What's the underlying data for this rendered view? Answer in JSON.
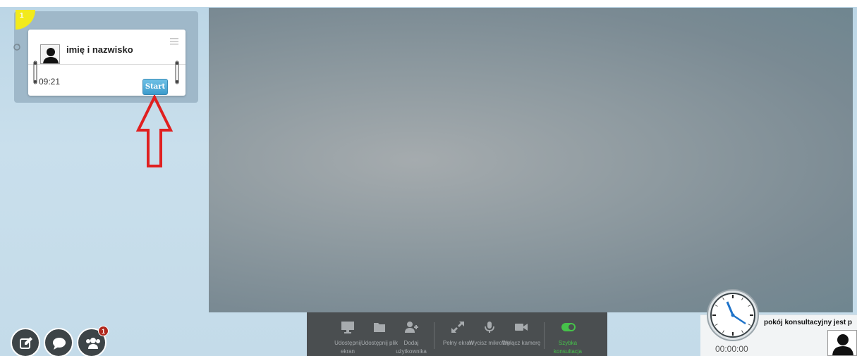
{
  "queue": {
    "count": "1",
    "client_name": "imię i nazwisko",
    "wait_time": "09:21",
    "start_label": "Start"
  },
  "footer_buttons": [
    {
      "icon": "edit-icon"
    },
    {
      "icon": "chat-icon"
    },
    {
      "icon": "users-icon",
      "badge": "1"
    }
  ],
  "toolbar": {
    "items": [
      {
        "icon": "monitor-icon",
        "label": "Udostępnij ekran"
      },
      {
        "icon": "folder-icon",
        "label": "Udostępnij plik"
      },
      {
        "icon": "add-user-icon",
        "label": "Dodaj użytkownika"
      },
      {
        "icon": "expand-icon",
        "label": "Pełny ekran"
      },
      {
        "icon": "microphone-icon",
        "label": "Wycisz mikrofon"
      },
      {
        "icon": "camera-icon",
        "label": "Wyłącz kamerę"
      },
      {
        "icon": "toggle-icon",
        "label": "Szybka konsultacja"
      }
    ]
  },
  "status": {
    "room_text": "pokój konsultacyjny jest p",
    "timer": "00:00:00"
  },
  "colors": {
    "accent_yellow": "#f2ea1c",
    "start_button": "#4aa9d6",
    "toolbar_bg": "#4a4e50",
    "quick_consult": "#46c24a",
    "annotation_arrow": "#e02020"
  }
}
